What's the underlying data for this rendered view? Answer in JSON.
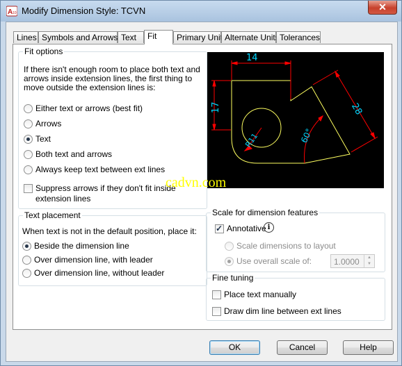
{
  "window": {
    "title": "Modify Dimension Style: TCVN",
    "close_label": "✕"
  },
  "tabs": [
    {
      "label": "Lines",
      "active": false
    },
    {
      "label": "Symbols and Arrows",
      "active": false
    },
    {
      "label": "Text",
      "active": false
    },
    {
      "label": "Fit",
      "active": true
    },
    {
      "label": "Primary Units",
      "active": false
    },
    {
      "label": "Alternate Units",
      "active": false
    },
    {
      "label": "Tolerances",
      "active": false
    }
  ],
  "fit_options": {
    "title": "Fit options",
    "description": [
      "If there isn't enough room to place both text and",
      "arrows inside extension lines, the first thing to",
      "move outside the extension lines is:"
    ],
    "options": [
      {
        "label": "Either text or arrows (best fit)",
        "selected": false
      },
      {
        "label": "Arrows",
        "selected": false
      },
      {
        "label": "Text",
        "selected": true
      },
      {
        "label": "Both text and arrows",
        "selected": false
      },
      {
        "label": "Always keep text between ext lines",
        "selected": false
      }
    ],
    "suppress": {
      "label_line1": "Suppress arrows if they don't fit inside",
      "label_line2": "extension lines",
      "checked": false
    }
  },
  "text_placement": {
    "title": "Text placement",
    "description": "When text is not in the default position, place it:",
    "options": [
      {
        "label": "Beside the dimension line",
        "selected": true
      },
      {
        "label": "Over dimension line, with leader",
        "selected": false
      },
      {
        "label": "Over dimension line, without leader",
        "selected": false
      }
    ]
  },
  "scale": {
    "title": "Scale for dimension features",
    "annotative": {
      "label": "Annotative",
      "checked": true
    },
    "layout": {
      "label": "Scale dimensions to layout",
      "selected": false
    },
    "overall": {
      "label": "Use overall scale of:",
      "selected": true,
      "value": "1.0000"
    }
  },
  "fine_tuning": {
    "title": "Fine tuning",
    "place_manually": {
      "label": "Place text manually",
      "checked": false
    },
    "draw_dim_line": {
      "label": "Draw dim line between ext lines",
      "checked": false
    }
  },
  "preview": {
    "dim_top": "14",
    "dim_left": "17",
    "dim_diag": "28",
    "dim_radius": "R11",
    "dim_angle": "60°",
    "watermark": "cadvn.com",
    "colors": {
      "dimension": "#ff0000",
      "text": "#00d7ff",
      "outline": "#ffff60",
      "watermark": "#ffff00"
    }
  },
  "buttons": {
    "ok": "OK",
    "cancel": "Cancel",
    "help": "Help"
  }
}
